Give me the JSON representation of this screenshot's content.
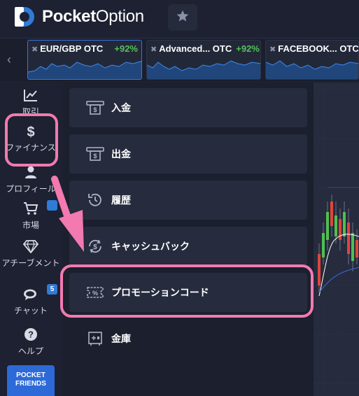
{
  "header": {
    "brand_bold": "Pocket",
    "brand_light": "Option",
    "favorite_icon": "star-icon"
  },
  "asset_strip": {
    "tiles": [
      {
        "name": "EUR/GBP OTC",
        "payout": "+92%"
      },
      {
        "name": "Advanced... OTC",
        "payout": "+92%"
      },
      {
        "name": "FACEBOOK... OTC",
        "payout": "+"
      }
    ]
  },
  "sidebar": {
    "items": [
      {
        "label": "取引",
        "icon": "chart-icon"
      },
      {
        "label": "ファイナンス",
        "icon": "dollar-icon"
      },
      {
        "label": "プロフィール",
        "icon": "user-icon"
      },
      {
        "label": "市場",
        "icon": "cart-icon"
      },
      {
        "label": "アチーブメント",
        "icon": "diamond-icon"
      },
      {
        "label": "チャット",
        "icon": "chat-icon",
        "badge": "5"
      },
      {
        "label": "ヘルプ",
        "icon": "help-icon"
      }
    ],
    "market_badge": "",
    "pocket_friends": {
      "line1": "POCKET",
      "line2": "FRIENDS"
    }
  },
  "finance_menu": {
    "items": [
      {
        "label": "入金",
        "icon": "deposit-icon"
      },
      {
        "label": "出金",
        "icon": "withdraw-icon"
      },
      {
        "label": "履歴",
        "icon": "history-icon"
      },
      {
        "label": "キャッシュバック",
        "icon": "cashback-icon"
      },
      {
        "label": "プロモーションコード",
        "icon": "promo-code-icon"
      },
      {
        "label": "金庫",
        "icon": "safe-icon"
      }
    ]
  },
  "colors": {
    "accent": "#2f7bd8",
    "highlight": "#f27ab0",
    "payout_green": "#56c15b"
  }
}
